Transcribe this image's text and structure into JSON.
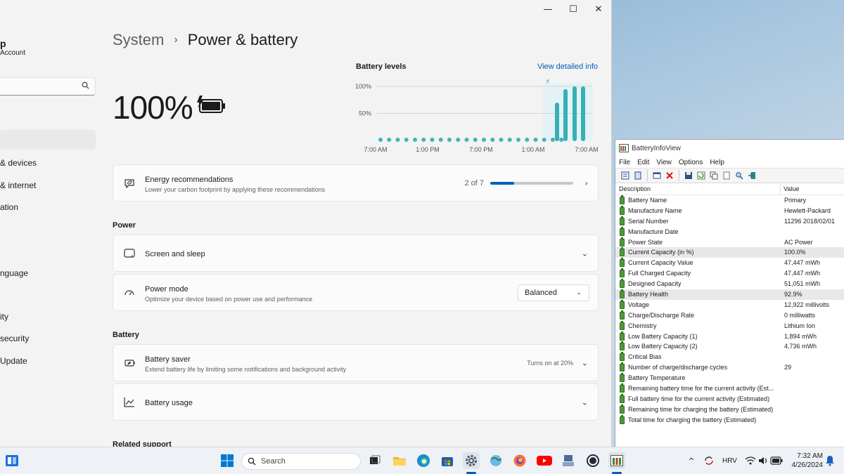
{
  "settings": {
    "window_controls": {
      "minimize": "—",
      "maximize": "☐",
      "close": "✕"
    },
    "profile": {
      "name": "p",
      "account": "Account"
    },
    "sidebar_items": [
      "& devices",
      "& internet",
      "ation",
      "nguage",
      "ity",
      "security",
      "Update"
    ],
    "breadcrumb": {
      "parent": "System",
      "separator": "›",
      "current": "Power & battery"
    },
    "battery_percent": "100%",
    "chart_title": "Battery levels",
    "chart_link": "View detailed info",
    "energy": {
      "title": "Energy recommendations",
      "subtitle": "Lower your carbon footprint by applying these recommendations",
      "progress_text": "2 of 7",
      "progress_fraction": 0.286
    },
    "power_section": "Power",
    "screen_sleep": {
      "title": "Screen and sleep"
    },
    "power_mode": {
      "title": "Power mode",
      "subtitle": "Optimize your device based on power use and performance",
      "value": "Balanced"
    },
    "battery_section": "Battery",
    "battery_saver": {
      "title": "Battery saver",
      "subtitle": "Extend battery life by limiting some notifications and background activity",
      "status": "Turns on at 20%"
    },
    "battery_usage": {
      "title": "Battery usage"
    },
    "related_support": "Related support"
  },
  "chart_data": {
    "type": "bar",
    "title": "Battery levels",
    "y_tick_labels": [
      "100%",
      "50%"
    ],
    "x_tick_labels": [
      "7:00 AM",
      "1:00 PM",
      "7:00 PM",
      "1:00 AM",
      "7:00 AM"
    ],
    "ylim": [
      0,
      100
    ],
    "grid": true,
    "dots": 22,
    "values": [
      70,
      95,
      100,
      100
    ],
    "charging_marker": "⚡"
  },
  "biv": {
    "title": "BatteryInfoView",
    "menu": [
      "File",
      "Edit",
      "View",
      "Options",
      "Help"
    ],
    "headers": {
      "description": "Description",
      "value": "Value"
    },
    "rows": [
      {
        "d": "Battery Name",
        "v": "Primary"
      },
      {
        "d": "Manufacture Name",
        "v": "Hewlett-Packard"
      },
      {
        "d": "Serial Number",
        "v": "11296 2018/02/01"
      },
      {
        "d": "Manufacture Date",
        "v": ""
      },
      {
        "d": "Power State",
        "v": "AC Power"
      },
      {
        "d": "Current Capacity (in %)",
        "v": "100.0%"
      },
      {
        "d": "Current Capacity Value",
        "v": "47,447 mWh"
      },
      {
        "d": "Full Charged Capacity",
        "v": "47,447 mWh"
      },
      {
        "d": "Designed Capacity",
        "v": "51,051 mWh"
      },
      {
        "d": "Battery Health",
        "v": "92.9%"
      },
      {
        "d": "Voltage",
        "v": "12,922 millivolts"
      },
      {
        "d": "Charge/Discharge Rate",
        "v": "0 milliwatts"
      },
      {
        "d": "Chemistry",
        "v": "Lithium Ion"
      },
      {
        "d": "Low Battery Capacity (1)",
        "v": "1,894 mWh"
      },
      {
        "d": "Low Battery Capacity (2)",
        "v": "4,736 mWh"
      },
      {
        "d": "Critical Bias",
        "v": ""
      },
      {
        "d": "Number of charge/discharge cycles",
        "v": "29"
      },
      {
        "d": "Battery Temperature",
        "v": ""
      },
      {
        "d": "Remaining battery time for the current activity (Est...",
        "v": ""
      },
      {
        "d": "Full battery time for the current activity (Estimated)",
        "v": ""
      },
      {
        "d": "Remaining time for charging the battery (Estimated)",
        "v": ""
      },
      {
        "d": "Total  time for charging the battery (Estimated)",
        "v": ""
      }
    ]
  },
  "taskbar": {
    "search_placeholder": "Search",
    "language": "HRV",
    "time": "7:32 AM",
    "date": "4/26/2024"
  }
}
